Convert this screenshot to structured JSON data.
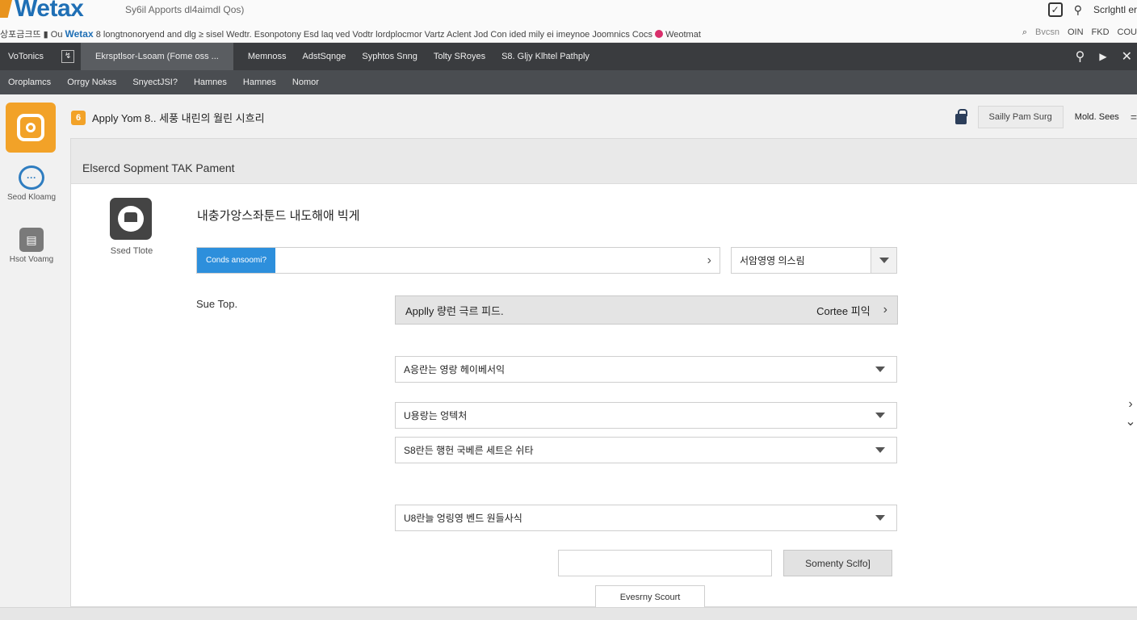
{
  "header": {
    "logo": "Wetax",
    "subtitle": "Sy6il Apports dl4aimdl Qos)",
    "right_label": "Scrlghtl er",
    "ticker_prefix": "상포금크뜨 ▮  Ou",
    "ticker_brand": "Wetax",
    "ticker_text": "8 longtnonoryend and dlg ≥ sisel Wedtr. Esonpotony Esd laq ved Vodtr lordplocmor Vartz Aclent Jod Con ided mily ei imeynoe Joomnics Cocs",
    "ticker_end": "Weotmat",
    "ticker_right": [
      "Bvcsn",
      "OIN",
      "FKD",
      "COU"
    ]
  },
  "nav1": {
    "items": [
      "VoTonics",
      "Ekrsptlsor-Lsoam (Fome oss ...",
      "Memnoss",
      "AdstSqnge",
      "Syphtos Snng",
      "Tolty SRoyes",
      "S8. Gljy Klhtel Pathply"
    ]
  },
  "nav2": {
    "items": [
      "Oroplamcs",
      "Orrgy Nokss",
      "SnyectJSI?",
      "Hamnes",
      "Hamnes",
      "Nomor"
    ]
  },
  "rail": {
    "items": [
      "Seod Kloamg",
      "Hsot Voamg"
    ]
  },
  "page": {
    "badge": "6",
    "title": "Apply Yom 8.. 세풍 내린의 월린 시흐리",
    "right_button": "Sailly Pam Surg",
    "right_link": "Mold. Sees"
  },
  "panel": {
    "header": "Elsercd Sopment TAK Pament",
    "tile_label": "Ssed Tlote",
    "title": "내충가앙스좌툰드 내도해애 빅게",
    "segment_button": "Conds ansoomi?",
    "small_select": "서암영영 의스림",
    "side_label": "Sue Top.",
    "apply_left": "Applly 량런 극르 피드.",
    "apply_right": "Cortee 피익",
    "dropdowns": [
      "A응란는 영랑 헤이베서익",
      "U용랑는 엉텍처",
      "S8란든 행헌 국베른 세트은 쉬타",
      "U8란늘 엉링영 벤드 원들사식"
    ],
    "btn_grey": "Somenty Sclfo]",
    "btn_white": "Evesrny Scourt"
  }
}
